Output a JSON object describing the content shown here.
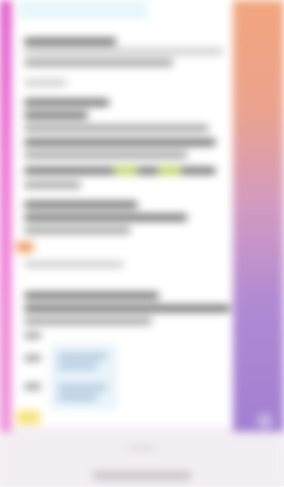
{
  "colors": {
    "left_accent": "#e056c9",
    "right_gradient_top": "#f2a57d",
    "right_gradient_bottom": "#a27fd2",
    "link_highlight": "#c9e264",
    "card_fill": "#e9f4fb",
    "nav_bar": "#f3eef4"
  },
  "icons": {
    "orange_marker": "orange-dot-icon",
    "yellow_chip": "yellow-chip-icon",
    "corner": "circle-icon",
    "home_indicator": "home-indicator-icon"
  }
}
